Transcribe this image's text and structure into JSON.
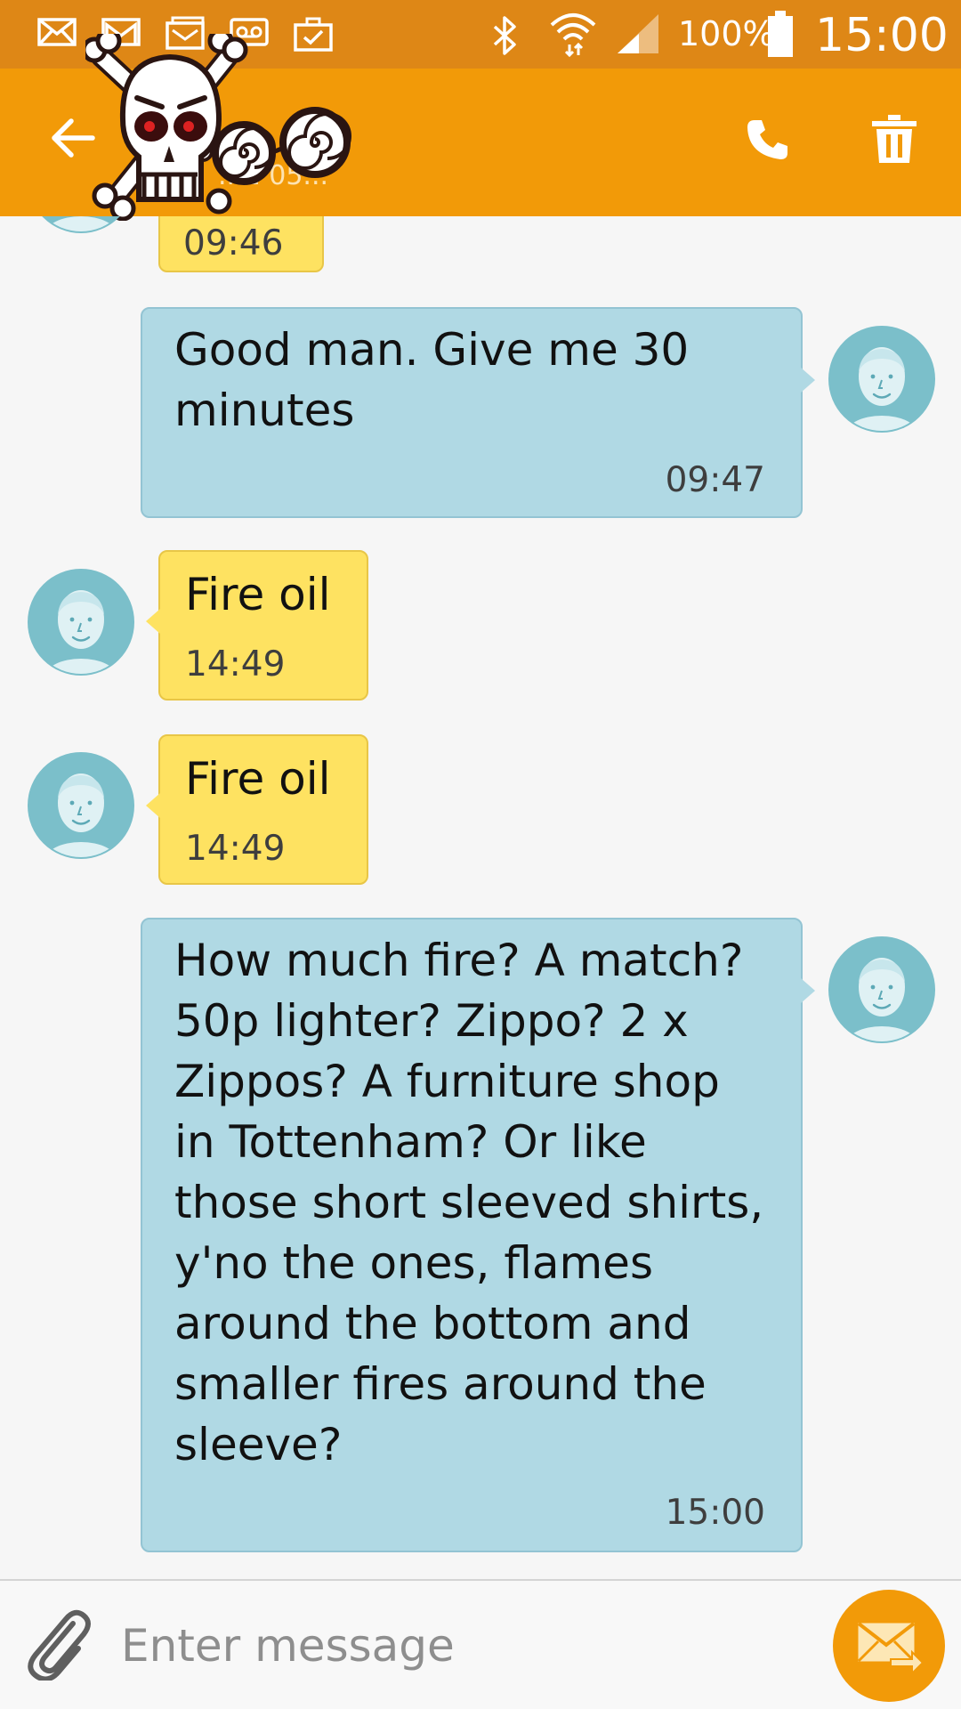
{
  "status_bar": {
    "battery_percent": "100%",
    "time": "15:00",
    "icons": [
      "mail-icon",
      "gmail-icon",
      "outlook-icon",
      "voicemail-icon",
      "briefcase-check-icon",
      "bluetooth-icon",
      "wifi-icon",
      "signal-icon",
      "battery-icon"
    ]
  },
  "app_bar": {
    "contact_name": "...1 05...",
    "icons": [
      "back-arrow-icon",
      "phone-icon",
      "trash-icon"
    ]
  },
  "sticker": "skull-crossbones-sticker",
  "messages": [
    {
      "direction": "incoming",
      "time": "09:46"
    },
    {
      "direction": "outgoing",
      "text": "Good man. Give me 30\nminutes",
      "time": "09:47"
    },
    {
      "direction": "incoming",
      "text": "Fire oil",
      "time": "14:49"
    },
    {
      "direction": "incoming",
      "text": "Fire oil",
      "time": "14:49"
    },
    {
      "direction": "outgoing",
      "text": "How much fire? A match?\n50p lighter? Zippo? 2 x\nZippos? A furniture shop\nin Tottenham? Or like\nthose short sleeved shirts,\ny'no the ones, flames\naround the bottom and\nsmaller fires around the\nsleeve?",
      "time": "15:00"
    }
  ],
  "composer": {
    "placeholder": "Enter message",
    "icons": [
      "paperclip-icon",
      "send-mail-icon"
    ]
  },
  "colors": {
    "status_bar": "#de8716",
    "app_bar": "#f29a08",
    "incoming_bubble": "#fee261",
    "outgoing_bubble": "#b0d9e4",
    "background": "#f6f6f6",
    "avatar": "#7bbfca"
  }
}
